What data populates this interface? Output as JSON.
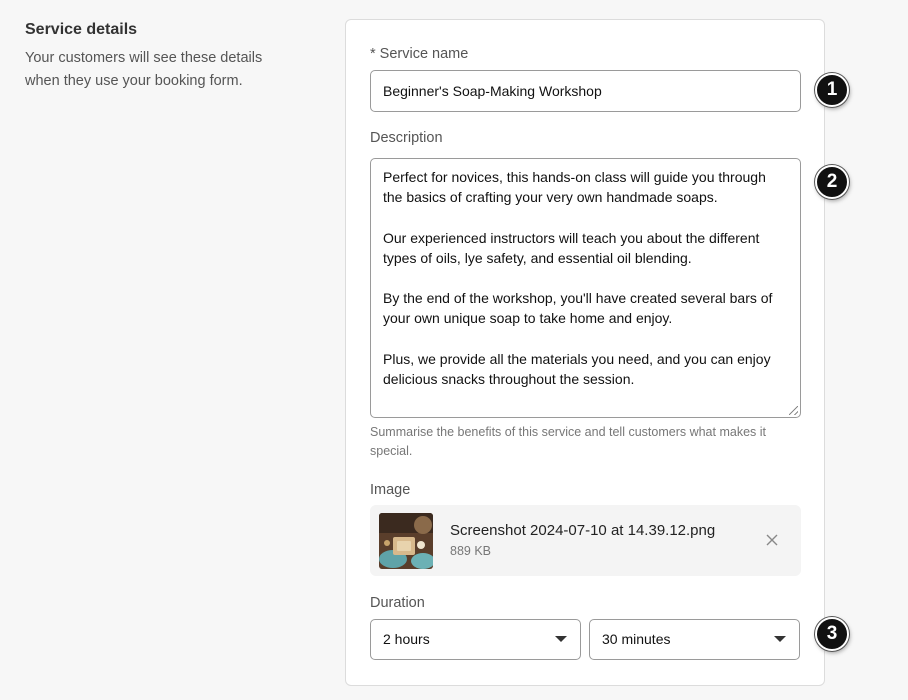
{
  "section": {
    "title": "Service details",
    "description": "Your customers will see these details when they use your booking form."
  },
  "form": {
    "service_name": {
      "label": "* Service name",
      "value": "Beginner's Soap-Making Workshop"
    },
    "description": {
      "label": "Description",
      "paragraphs": [
        "Perfect for novices, this hands-on class will guide you through the basics of crafting your very own handmade soaps.",
        "Our experienced instructors will teach you about the different types of oils, lye safety, and essential oil blending.",
        "By the end of the workshop, you'll have created several bars of your own unique soap to take home and enjoy.",
        "Plus, we provide all the materials you need, and you can enjoy delicious snacks throughout the session."
      ],
      "hint": "Summarise the benefits of this service and tell customers what makes it special."
    },
    "image": {
      "label": "Image",
      "file_name": "Screenshot 2024-07-10 at 14.39.12.png",
      "file_size": "889 KB",
      "remove_icon": "close-icon"
    },
    "duration": {
      "label": "Duration",
      "hours": "2 hours",
      "minutes": "30 minutes",
      "dropdown_icon": "chevron-down-icon"
    }
  },
  "markers": [
    "1",
    "2",
    "3"
  ],
  "colors": {
    "background": "#f7f7f7",
    "card": "#ffffff",
    "border": "#9a9a9a",
    "marker": "#111111"
  }
}
